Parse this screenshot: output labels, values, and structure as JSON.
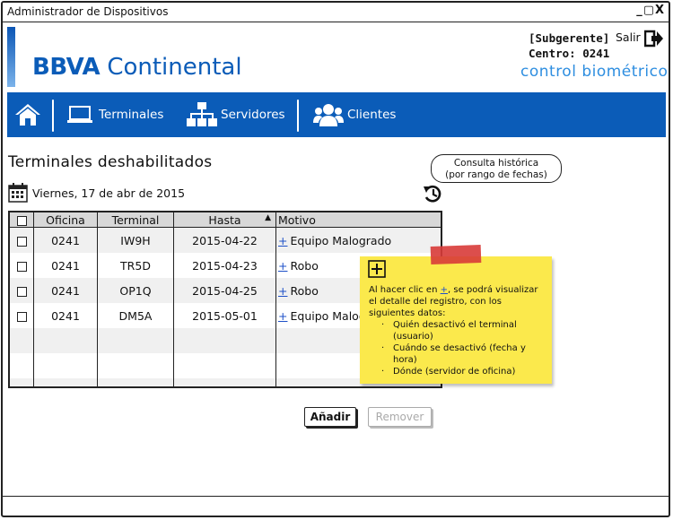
{
  "window": {
    "title": "Administrador de Dispositivos",
    "controls": "_▢X"
  },
  "header": {
    "logo_bold": "BBVA",
    "logo_rest": " Continental",
    "user_role": "[Subgerente]",
    "user_center": "Centro: 0241",
    "logout_label": "Salir",
    "app_name": "control biométrico"
  },
  "nav": {
    "terminales": "Terminales",
    "servidores": "Servidores",
    "clientes": "Clientes"
  },
  "page": {
    "title": "Terminales deshabilitados",
    "date": "Viernes, 17 de abr de 2015",
    "history_tooltip_line1": "Consulta histórica",
    "history_tooltip_line2": "(por rango de fechas)"
  },
  "table": {
    "columns": [
      "",
      "Oficina",
      "Terminal",
      "Hasta",
      "Motivo"
    ],
    "sort_indicator": "▲",
    "rows": [
      {
        "oficina": "0241",
        "terminal": "IW9H",
        "hasta": "2015-04-22",
        "motivo": "Equipo Malogrado"
      },
      {
        "oficina": "0241",
        "terminal": "TR5D",
        "hasta": "2015-04-23",
        "motivo": "Robo"
      },
      {
        "oficina": "0241",
        "terminal": "OP1Q",
        "hasta": "2015-04-25",
        "motivo": "Robo"
      },
      {
        "oficina": "0241",
        "terminal": "DM5A",
        "hasta": "2015-05-01",
        "motivo": "Equipo Malog"
      }
    ],
    "plus": "+"
  },
  "buttons": {
    "add": "Añadir",
    "remove": "Remover"
  },
  "note": {
    "intro_pre": "Al hacer clic en ",
    "intro_plus": "+",
    "intro_post": ", se podrá visualizar el detalle del registro, con los siguientes datos:",
    "items": [
      "Quién desactivó el terminal (usuario)",
      "Cuándo se desactivó (fecha y hora)",
      "Dónde (servidor de oficina)"
    ]
  },
  "colors": {
    "brand": "#0b5cb8",
    "accent": "#2e8ee0",
    "note": "#fbe94c",
    "tape": "#d83b38"
  }
}
